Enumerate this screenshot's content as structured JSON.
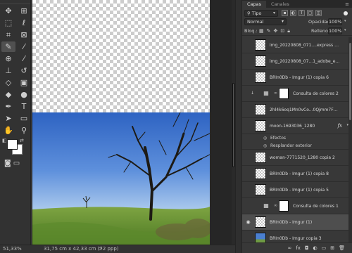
{
  "panel": {
    "tabs": [
      {
        "label": "Capas",
        "active": true
      },
      {
        "label": "Canales",
        "active": false
      }
    ],
    "filter_kind": "Tipo",
    "blend_mode": "Normal",
    "opacity_label": "Opacidad:",
    "opacity_value": "100%",
    "lock_label": "Bloq.:",
    "fill_label": "Relleno:",
    "fill_value": "100%",
    "layers": [
      {
        "name": "img_20220808_071....express copia 4",
        "type": "image",
        "visible": false,
        "fx": false
      },
      {
        "name": "img_20220808_07...1_adobe_express",
        "type": "image",
        "visible": false,
        "fx": false
      },
      {
        "name": "BRIn0Db - Imgur (1) copia 6",
        "type": "image",
        "visible": false,
        "fx": false
      },
      {
        "name": "Consulta de colores 2",
        "type": "adjustment",
        "visible": false,
        "fx": false,
        "clipped": true
      },
      {
        "name": "2hl4k6oq1Mn0vCo...0Qjmm7Fbxa0ijWlt",
        "type": "image",
        "visible": false,
        "fx": false
      },
      {
        "name": "moon-1693036_1280",
        "type": "image",
        "visible": false,
        "fx": true
      },
      {
        "name": "Efectos",
        "type": "effects"
      },
      {
        "name": "Resplandor exterior",
        "type": "effects"
      },
      {
        "name": "woman-7771520_1280 copia 2",
        "type": "image",
        "visible": false,
        "fx": false
      },
      {
        "name": "BRIn0Db - Imgur (1) copia 8",
        "type": "image",
        "visible": false,
        "fx": false
      },
      {
        "name": "BRIn0Db - Imgur (1) copia 5",
        "type": "image",
        "visible": false,
        "fx": false
      },
      {
        "name": "Consulta de colores 1",
        "type": "adjustment",
        "visible": false,
        "fx": false,
        "clipped": false
      },
      {
        "name": "BRIn0Db - Imgur (1)",
        "type": "image",
        "visible": true,
        "fx": false,
        "selected": true
      },
      {
        "name": "BRIn0Db - Imgur copia 3",
        "type": "photo",
        "visible": false,
        "fx": false
      }
    ]
  },
  "status": {
    "zoom": "51,33%",
    "doc_size": "31,75 cm x 42,33 cm (72 ppp)",
    "arrow": ">"
  },
  "colors": {
    "foreground": "#ffffff",
    "background": "#ffffff",
    "ui_dark": "#323232",
    "panel": "#383838",
    "selected_layer": "#4e4e4e"
  },
  "icons": {
    "tools": [
      "move-tool",
      "artboard-tool",
      "marquee-tool",
      "lasso-tool",
      "quick-select-tool",
      "crop-tool",
      "frame-tool",
      "eyedropper-tool",
      "healing-tool",
      "brush-tool",
      "stamp-tool",
      "history-brush-tool",
      "eraser-tool",
      "gradient-tool",
      "blur-tool",
      "dodge-tool",
      "pen-tool",
      "type-tool",
      "path-select-tool",
      "shape-tool",
      "hand-tool",
      "zoom-tool"
    ]
  }
}
